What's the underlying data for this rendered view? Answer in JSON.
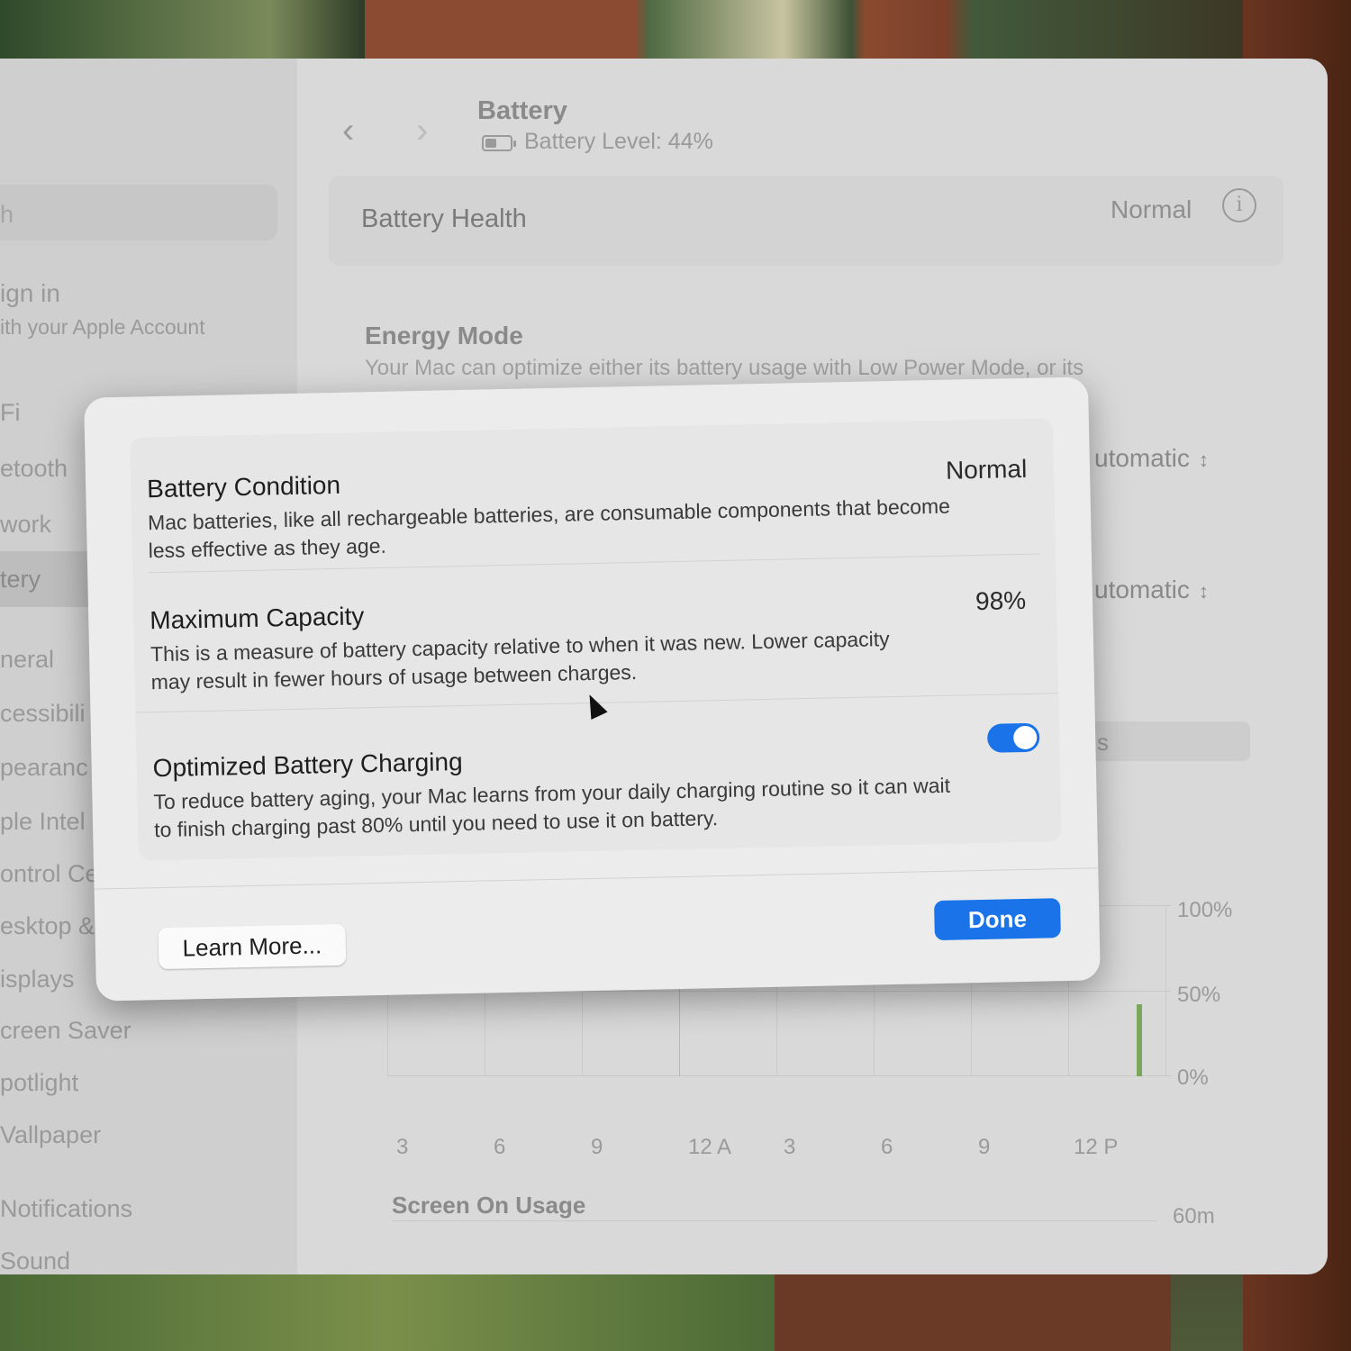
{
  "header": {
    "title": "Battery",
    "level_text": "Battery Level: 44%"
  },
  "sidebar": {
    "search_fragment": "h",
    "items": [
      {
        "label": "ign in"
      },
      {
        "label": "ith your Apple Account"
      },
      {
        "label": "Fi"
      },
      {
        "label": "etooth"
      },
      {
        "label": "work"
      },
      {
        "label": "tery"
      },
      {
        "label": "neral"
      },
      {
        "label": "cessibili"
      },
      {
        "label": "pearanc"
      },
      {
        "label": "ple Intel"
      },
      {
        "label": "ontrol Ce"
      },
      {
        "label": "esktop &"
      },
      {
        "label": "isplays"
      },
      {
        "label": "creen Saver"
      },
      {
        "label": "potlight"
      },
      {
        "label": "Vallpaper"
      },
      {
        "label": "Notifications"
      },
      {
        "label": "Sound"
      }
    ]
  },
  "main": {
    "health_label": "Battery Health",
    "health_value": "Normal",
    "energy_title": "Energy Mode",
    "energy_desc": "Your Mac can optimize either its battery usage with Low Power Mode, or its",
    "row1_value": "utomatic",
    "row2_value": "utomatic",
    "row3_fragment": "s",
    "chart": {
      "y_ticks": [
        "100%",
        "50%",
        "0%"
      ],
      "x_ticks": [
        "3",
        "6",
        "9",
        "12 A",
        "3",
        "6",
        "9",
        "12 P"
      ],
      "usage_title": "Screen On Usage",
      "usage_tick": "60m"
    }
  },
  "sheet": {
    "condition_title": "Battery Condition",
    "condition_value": "Normal",
    "condition_desc": "Mac batteries, like all rechargeable batteries, are consumable components that become less effective as they age.",
    "capacity_title": "Maximum Capacity",
    "capacity_value": "98%",
    "capacity_desc": "This is a measure of battery capacity relative to when it was new. Lower capacity may result in fewer hours of usage between charges.",
    "charging_title": "Optimized Battery Charging",
    "charging_desc": "To reduce battery aging, your Mac learns from your daily charging routine so it can wait to finish charging past 80% until you need to use it on battery.",
    "charging_enabled": true,
    "learn_more": "Learn More...",
    "done": "Done"
  },
  "colors": {
    "accent": "#1a73e8",
    "chart_bar": "#7aa85a"
  }
}
